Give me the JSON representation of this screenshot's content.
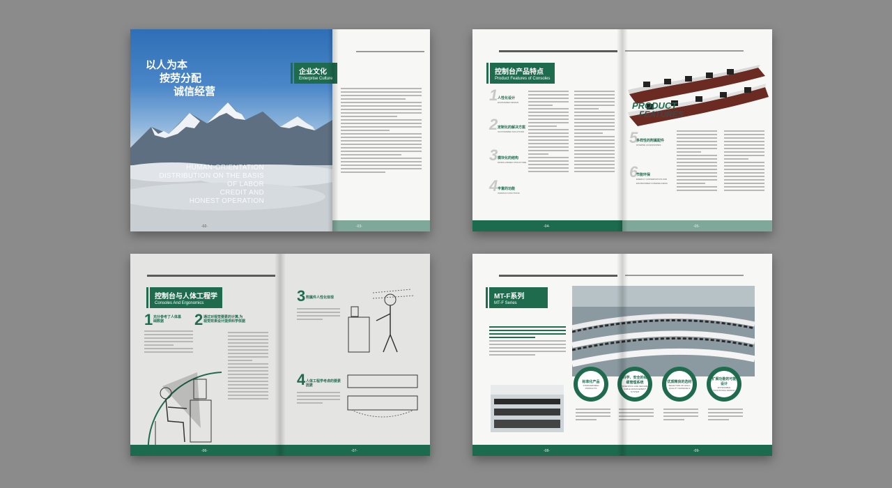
{
  "spread1": {
    "hero_lines": [
      "以人为本",
      "按劳分配",
      "诚信经营"
    ],
    "en_lines": [
      "HUMAN-ORIENTATION",
      "DISTRIBUTION ON THE BASIS",
      "OF LABOR",
      "CREDIT AND",
      "HONEST OPERATION"
    ],
    "heading_cn": "企业文化",
    "heading_en": "Enterprise Culture",
    "page_left": "-02-",
    "page_right": "-03-"
  },
  "spread2": {
    "heading_cn": "控制台产品特点",
    "heading_en": "Product Features of Consoles",
    "features": [
      {
        "num": "1",
        "cn": "人性化设计",
        "en": "HUMANIZED DESIGN"
      },
      {
        "num": "2",
        "cn": "定制化的解决方案",
        "en": "CUSTOMIZED SOLUTIONS"
      },
      {
        "num": "3",
        "cn": "模块化的结构",
        "en": "MODULARIZED STRUCTURE"
      },
      {
        "num": "4",
        "cn": "丰富的功能",
        "en": "VARIOUS FUNCTIONS"
      },
      {
        "num": "5",
        "cn": "多样性的附属配件",
        "en": "DIVERSE ACCESSORIES"
      },
      {
        "num": "6",
        "cn": "节能环保",
        "en": "ENERGY CONSERVATION AND ENVIRONMENT-FRIENDLINESS"
      }
    ],
    "product_word": "PRODUCT",
    "features_word": "FEATURES",
    "page_left": "-04-",
    "page_right": "-05-"
  },
  "spread3": {
    "heading_cn": "控制台与人体工程学",
    "heading_en": "Consoles And Ergonomics",
    "item1_num": "1",
    "item1_cn": "充分参考了人体基础数据",
    "item2_num": "2",
    "item2_cn": "通过对视觉要素的计算,为视觉效果设计提供科学依据",
    "item3_num": "3",
    "item3_cn": "附属件人性化体现",
    "item4_num": "4",
    "item4_cn": "人体工程学考虑的要素因素",
    "page_left": "-06-",
    "page_right": "-07-"
  },
  "spread4": {
    "heading_cn": "MT-F系列",
    "heading_en": "MT-F Series",
    "circles": [
      {
        "cn": "标准化产品",
        "en": "STANDARDIZED PRODUCTS"
      },
      {
        "cn": "科学、安全的线缆管理系统",
        "en": "SCIENTIFIC AND SECURE CABLE MANAGEMENT SYSTEM"
      },
      {
        "cn": "优质精良的选材",
        "en": "SELECTION OF HIGH-QUALITY MATERIALS"
      },
      {
        "cn": "扩展功能的可能设计",
        "en": "EXTENSIBLE FUNCTIONAL DESIGN"
      }
    ],
    "page_left": "-08-",
    "page_right": "-09-"
  },
  "colors": {
    "brand_green": "#1f6b4e",
    "background": "#8b8b8b",
    "sky_blue": "#4a86c8"
  }
}
